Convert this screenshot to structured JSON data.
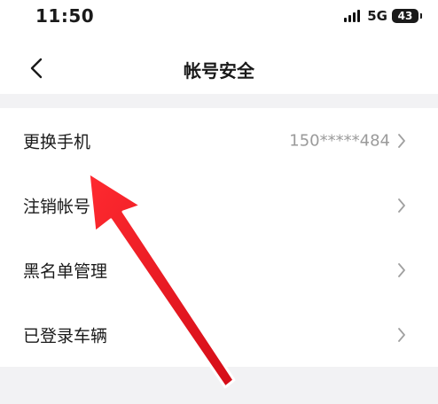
{
  "status_bar": {
    "time": "11:50",
    "network": "5G",
    "battery": "43"
  },
  "header": {
    "title": "帐号安全",
    "back_icon": "chevron-left-icon"
  },
  "settings": {
    "items": [
      {
        "label": "更换手机",
        "value": "150*****484"
      },
      {
        "label": "注销帐号",
        "value": ""
      },
      {
        "label": "黑名单管理",
        "value": ""
      },
      {
        "label": "已登录车辆",
        "value": ""
      }
    ]
  },
  "annotation": {
    "color": "#e8101d",
    "icon": "red-arrow-annotation"
  }
}
